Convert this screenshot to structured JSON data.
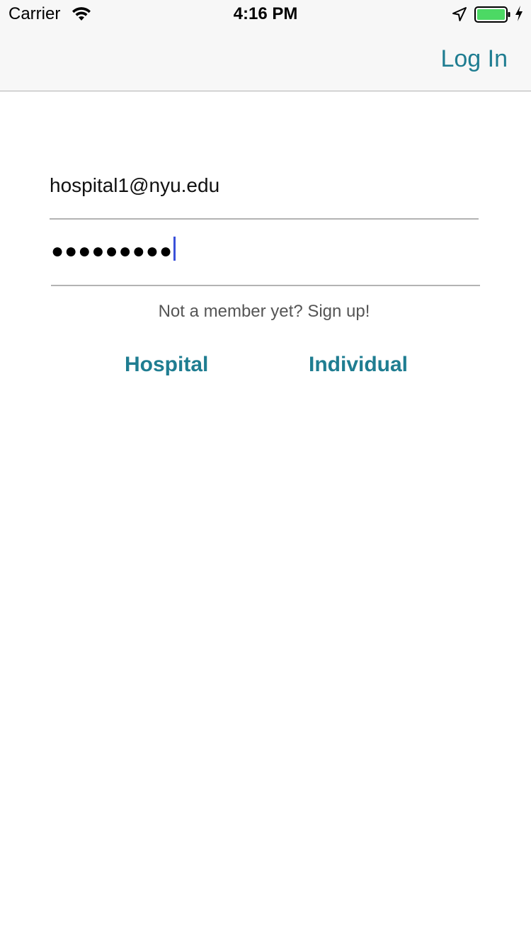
{
  "status_bar": {
    "carrier": "Carrier",
    "time": "4:16 PM",
    "icons": [
      "wifi-icon",
      "location-arrow-icon",
      "battery-icon",
      "charging-bolt-icon"
    ],
    "battery_color": "#4cd964"
  },
  "nav": {
    "login_label": "Log In"
  },
  "form": {
    "email_value": "hospital1@nyu.edu",
    "password_masked": "●●●●●●●●●"
  },
  "signup": {
    "prompt": "Not a member yet? Sign up!",
    "hospital_label": "Hospital",
    "individual_label": "Individual"
  },
  "colors": {
    "accent": "#1f7d91",
    "caret": "#3a50d9"
  }
}
